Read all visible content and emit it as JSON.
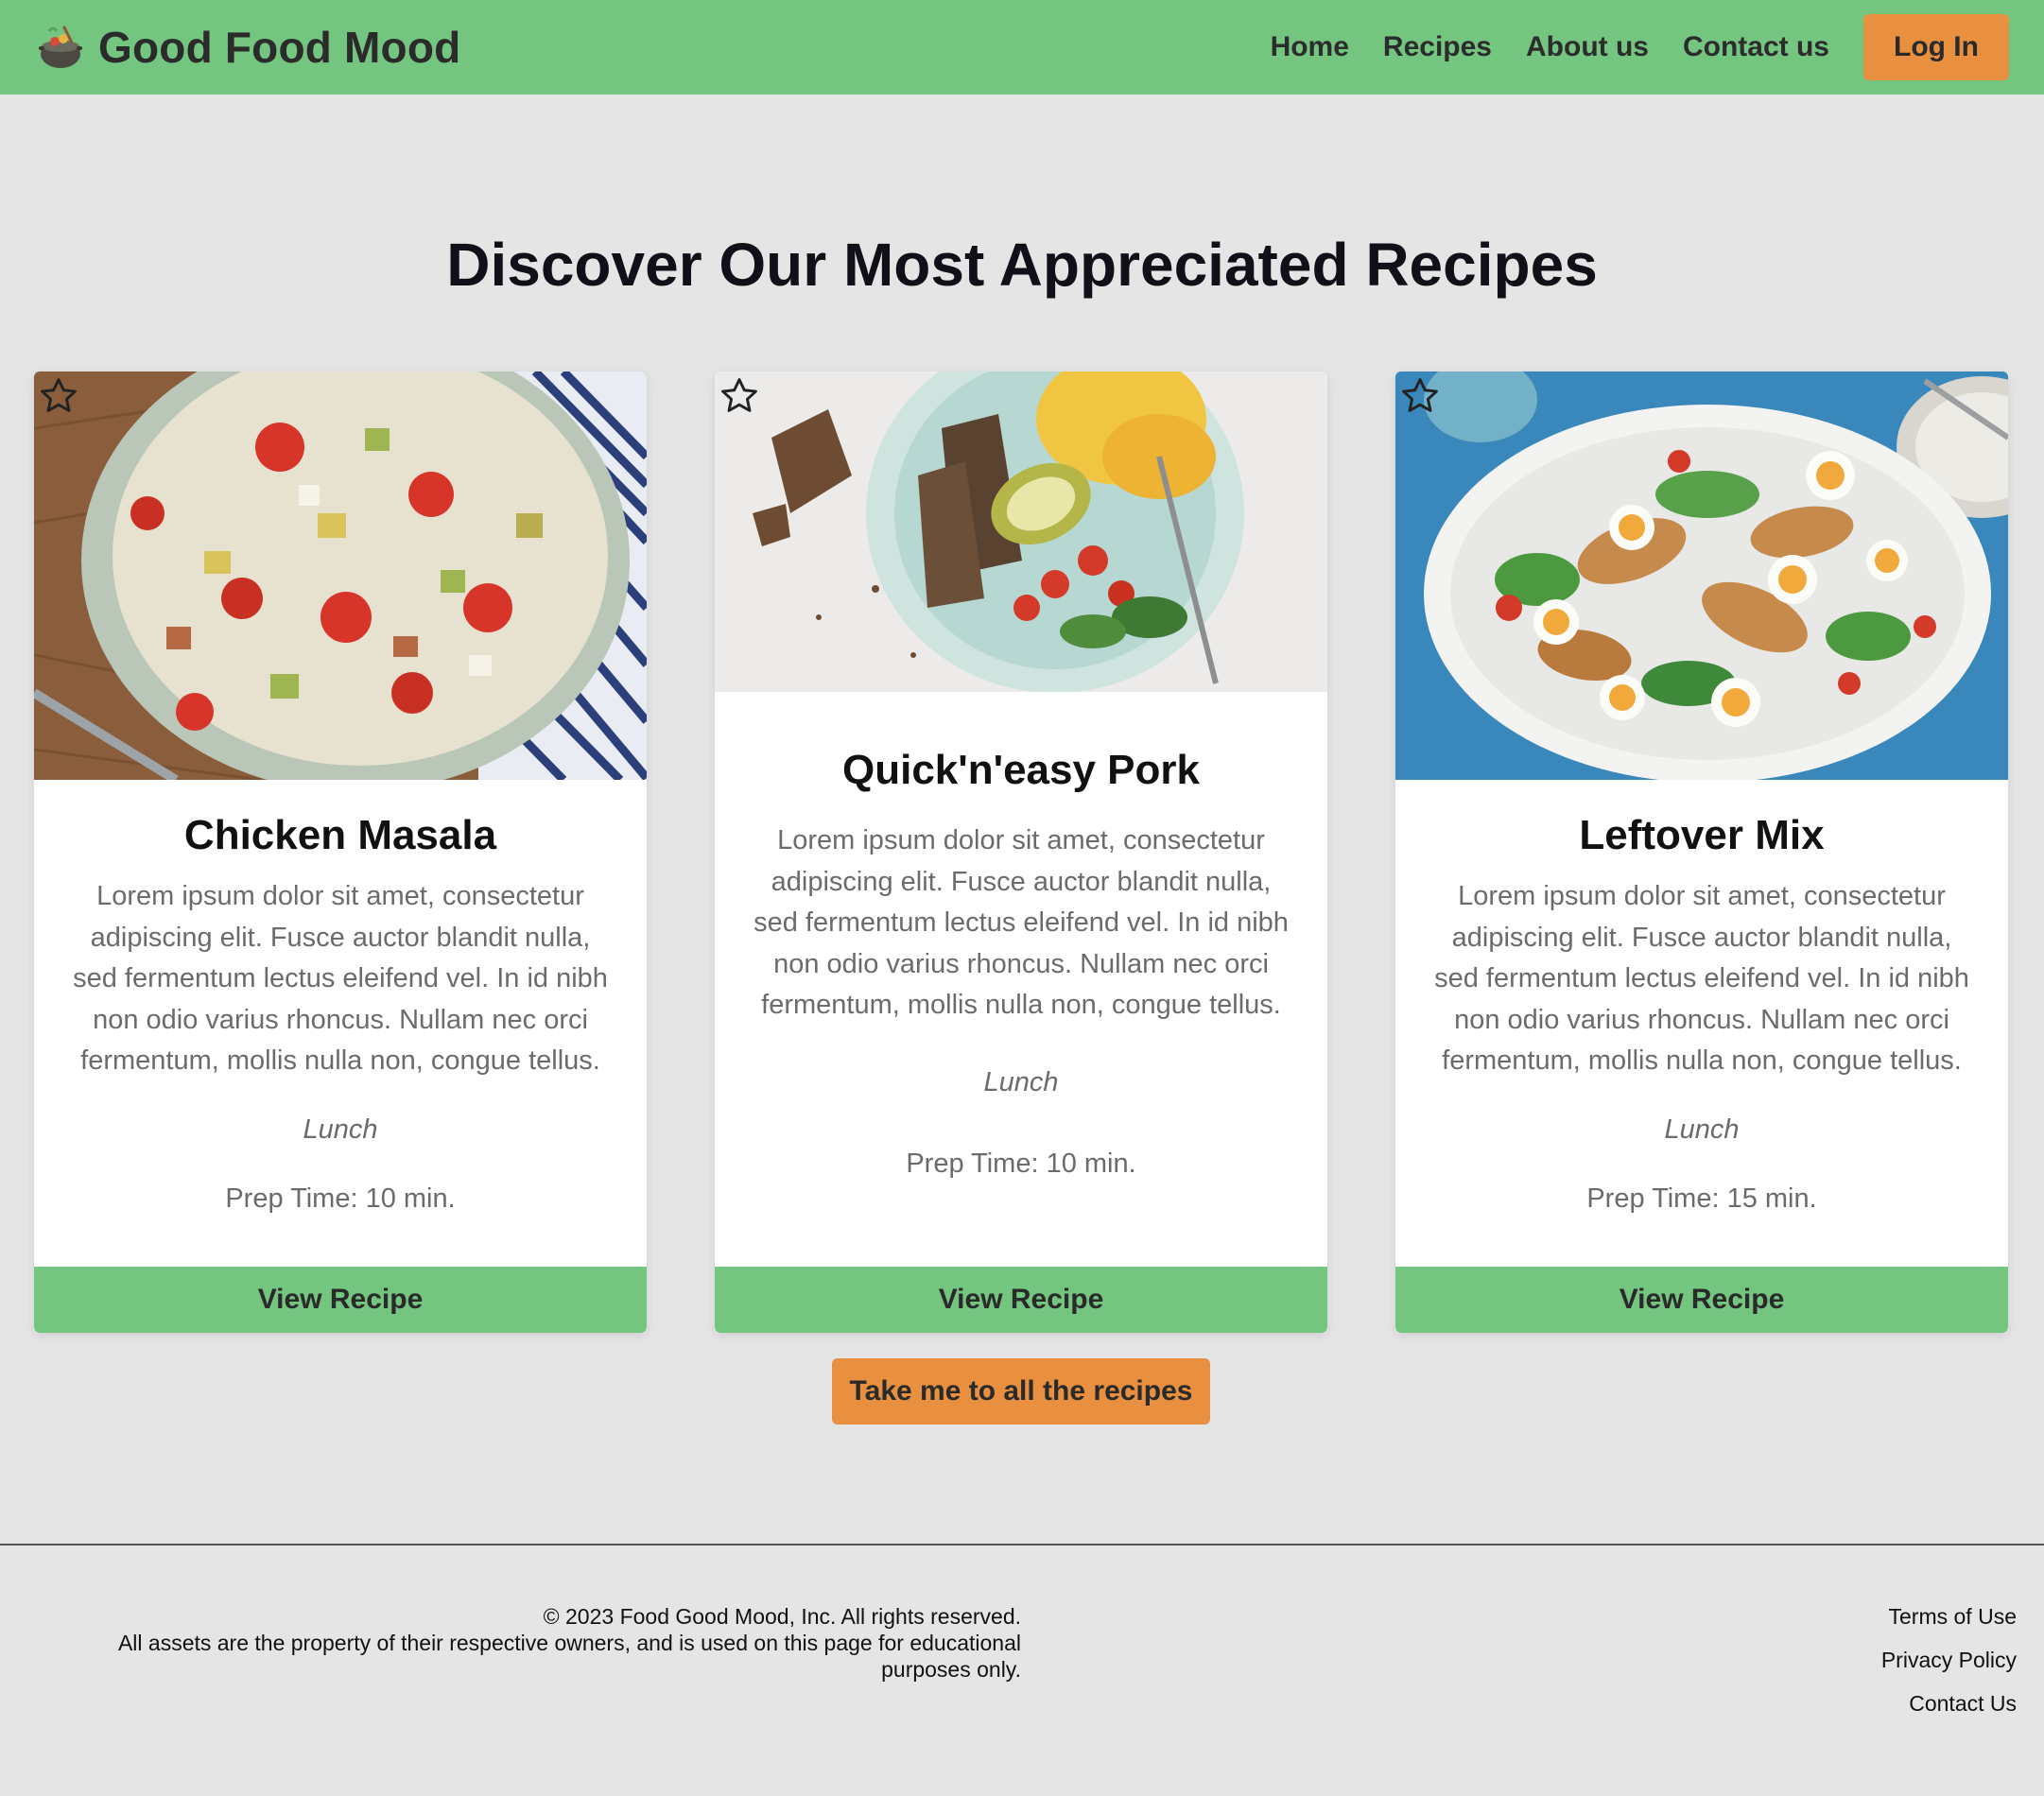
{
  "navbar": {
    "logo_icon": "cooking-pot-icon",
    "brand": "Good Food Mood",
    "links": [
      "Home",
      "Recipes",
      "About us",
      "Contact us"
    ],
    "login": "Log In"
  },
  "heading": "Discover Our Most Appreciated Recipes",
  "cards": [
    {
      "image": "salad-bowl-photo",
      "favorite_icon": "star-outline-icon",
      "title": "Chicken Masala",
      "description": "Lorem ipsum dolor sit amet, consectetur adipiscing elit. Fusce auctor blandit nulla, sed fermentum lectus eleifend vel. In id nibh non odio varius rhoncus. Nullam nec orci fermentum, mollis nulla non, congue tellus.",
      "category": "Lunch",
      "prep_time": "Prep Time: 10 min.",
      "button": "View Recipe"
    },
    {
      "image": "breakfast-plate-photo",
      "favorite_icon": "star-outline-icon",
      "title": "Quick'n'easy Pork",
      "description": "Lorem ipsum dolor sit amet, consectetur adipiscing elit. Fusce auctor blandit nulla, sed fermentum lectus eleifend vel. In id nibh non odio varius rhoncus. Nullam nec orci fermentum, mollis nulla non, congue tellus.",
      "category": "Lunch",
      "prep_time": "Prep Time: 10 min.",
      "button": "View Recipe"
    },
    {
      "image": "cobb-salad-platter-photo",
      "favorite_icon": "star-outline-icon",
      "title": "Leftover Mix",
      "description": "Lorem ipsum dolor sit amet, consectetur adipiscing elit. Fusce auctor blandit nulla, sed fermentum lectus eleifend vel. In id nibh non odio varius rhoncus. Nullam nec orci fermentum, mollis nulla non, congue tellus.",
      "category": "Lunch",
      "prep_time": "Prep Time: 15 min.",
      "button": "View Recipe"
    }
  ],
  "all_recipes_button": "Take me to all the recipes",
  "footer": {
    "copyright": "© 2023 Food Good Mood, Inc. All rights reserved.",
    "notice": "All assets are the property of their respective owners, and is used on this page for educational purposes only.",
    "links": [
      "Terms of Use",
      "Privacy Policy",
      "Contact Us"
    ]
  },
  "colors": {
    "header_green": "#73c57f",
    "accent_orange": "#e8903f",
    "page_background": "#e5e5e5",
    "card_background": "#ffffff"
  }
}
